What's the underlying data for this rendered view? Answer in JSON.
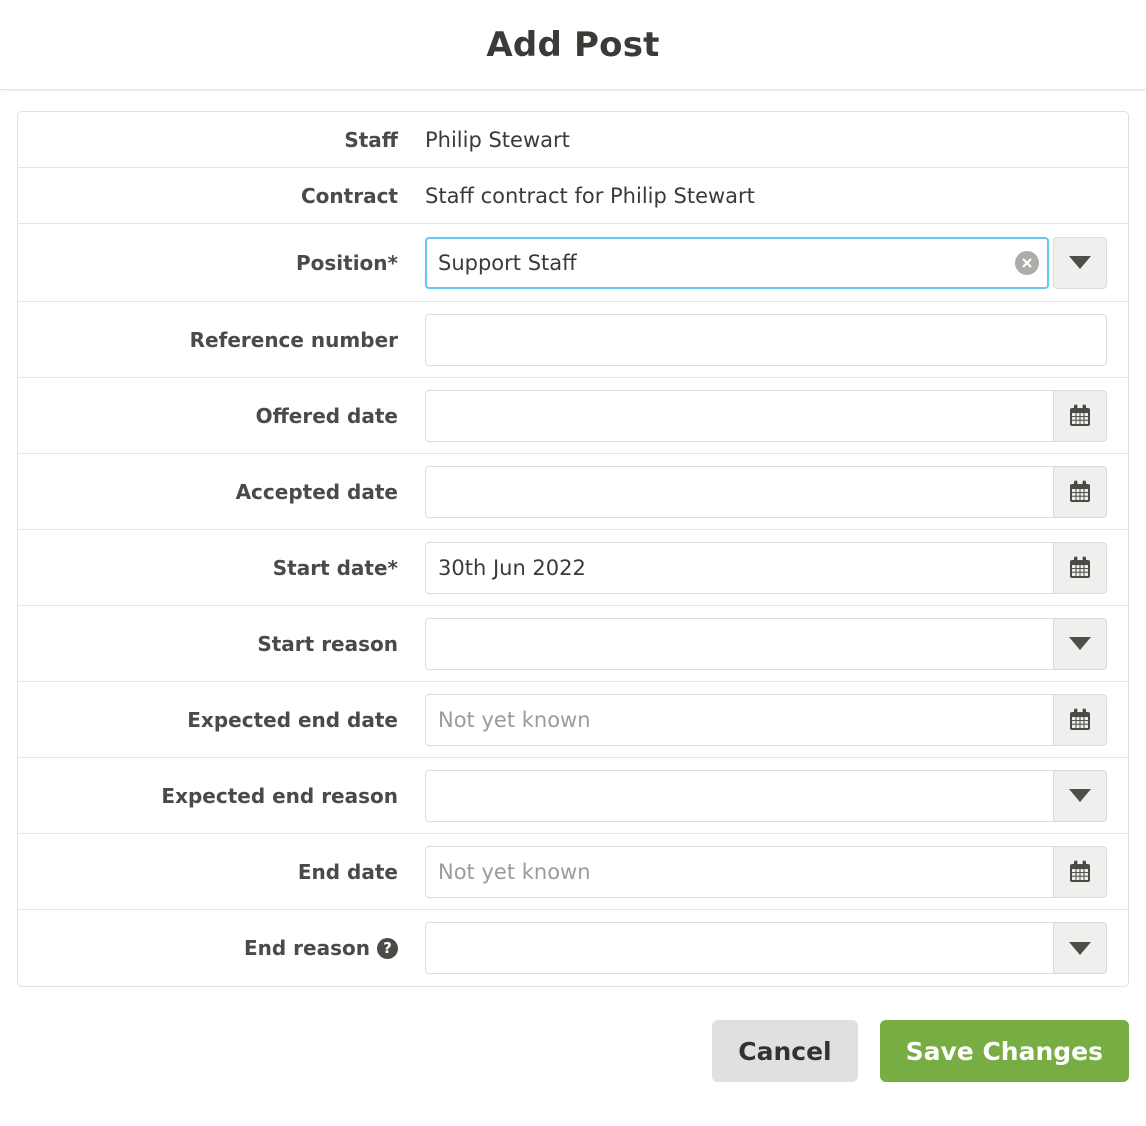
{
  "dialog": {
    "title": "Add Post"
  },
  "static_rows": [
    {
      "label": "Staff",
      "value": "Philip Stewart"
    },
    {
      "label": "Contract",
      "value": "Staff contract for Philip Stewart"
    }
  ],
  "fields": [
    {
      "label": "Position*",
      "type": "combobox",
      "value": "Support Staff",
      "placeholder": "",
      "focused": true,
      "clearable": true,
      "icon": "chevron-down-icon"
    },
    {
      "label": "Reference number",
      "type": "text",
      "value": "",
      "placeholder": "",
      "focused": false,
      "clearable": false,
      "icon": ""
    },
    {
      "label": "Offered date",
      "type": "date",
      "value": "",
      "placeholder": "",
      "focused": false,
      "clearable": false,
      "icon": "calendar-icon"
    },
    {
      "label": "Accepted date",
      "type": "date",
      "value": "",
      "placeholder": "",
      "focused": false,
      "clearable": false,
      "icon": "calendar-icon"
    },
    {
      "label": "Start date*",
      "type": "date",
      "value": "30th Jun 2022",
      "placeholder": "",
      "focused": false,
      "clearable": false,
      "icon": "calendar-icon"
    },
    {
      "label": "Start reason",
      "type": "select",
      "value": "",
      "placeholder": "",
      "focused": false,
      "clearable": false,
      "icon": "chevron-down-icon"
    },
    {
      "label": "Expected end date",
      "type": "date",
      "value": "",
      "placeholder": "Not yet known",
      "focused": false,
      "clearable": false,
      "icon": "calendar-icon"
    },
    {
      "label": "Expected end reason",
      "type": "select",
      "value": "",
      "placeholder": "",
      "focused": false,
      "clearable": false,
      "icon": "chevron-down-icon"
    },
    {
      "label": "End date",
      "type": "date",
      "value": "",
      "placeholder": "Not yet known",
      "focused": false,
      "clearable": false,
      "icon": "calendar-icon"
    },
    {
      "label": "End reason",
      "type": "select",
      "value": "",
      "placeholder": "",
      "focused": false,
      "clearable": false,
      "icon": "chevron-down-icon",
      "help": "help-icon",
      "help_glyph": "?"
    }
  ],
  "footer": {
    "cancel_label": "Cancel",
    "save_label": "Save Changes"
  },
  "colors": {
    "accent_green": "#78ad43",
    "focus_blue": "#63c9ee",
    "label_gray": "#4a4a47",
    "border_gray": "#dcdcdc"
  }
}
